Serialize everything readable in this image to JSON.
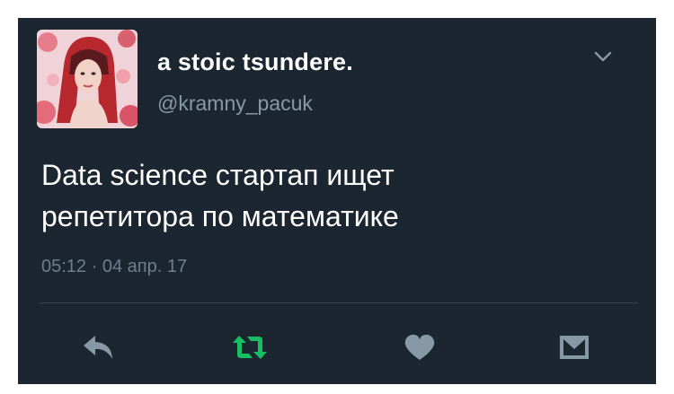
{
  "tweet": {
    "author": {
      "display_name": "a stoic tsundere.",
      "handle": "@kramny_pacuk",
      "avatar": "avatar-photo"
    },
    "text_lines": [
      "Data science стартап ищет",
      "репетитора по математике"
    ],
    "timestamp": "05:12 · 04 апр. 17",
    "menu_icon": "chevron-down-icon",
    "actions": [
      {
        "name": "reply",
        "icon": "reply-icon",
        "color": "#8899a6"
      },
      {
        "name": "retweet",
        "icon": "retweet-icon",
        "color": "#17bf63"
      },
      {
        "name": "like",
        "icon": "heart-icon",
        "color": "#8899a6"
      },
      {
        "name": "direct-message",
        "icon": "envelope-icon",
        "color": "#8899a6"
      }
    ]
  },
  "colors": {
    "card_background": "#1b2631",
    "text_primary": "#ffffff",
    "text_secondary": "#8899a6",
    "retweet_active": "#17bf63"
  }
}
